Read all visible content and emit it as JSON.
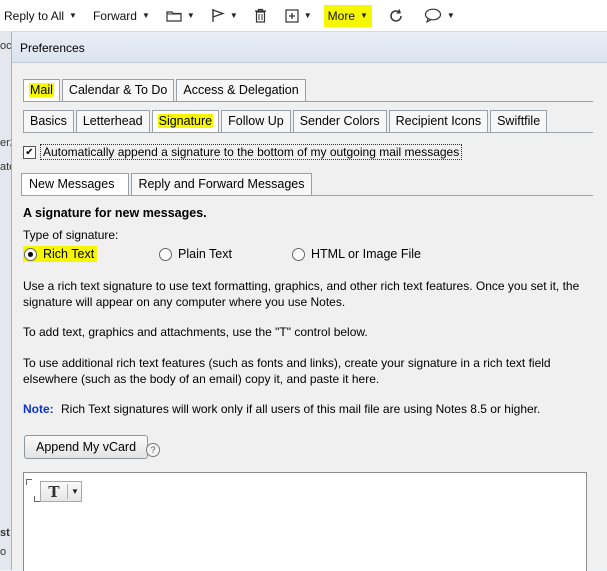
{
  "toolbar": {
    "reply_all": "Reply to All",
    "forward": "Forward",
    "more": "More",
    "icons": [
      "folder-icon",
      "flag-icon",
      "trash-icon",
      "add-box-icon",
      "refresh-icon",
      "chat-icon"
    ]
  },
  "dialog": {
    "title": "Preferences"
  },
  "main_tabs": [
    {
      "label": "Mail",
      "active": true
    },
    {
      "label": "Calendar & To Do",
      "active": false
    },
    {
      "label": "Access & Delegation",
      "active": false
    }
  ],
  "sub_tabs": [
    {
      "label": "Basics",
      "active": false
    },
    {
      "label": "Letterhead",
      "active": false
    },
    {
      "label": "Signature",
      "active": true
    },
    {
      "label": "Follow Up",
      "active": false
    },
    {
      "label": "Sender Colors",
      "active": false
    },
    {
      "label": "Recipient Icons",
      "active": false
    },
    {
      "label": "Swiftfile",
      "active": false
    }
  ],
  "auto_append": {
    "label": "Automatically append a signature to the bottom of my outgoing mail messages",
    "checked": true
  },
  "message_tabs": [
    {
      "label": "New Messages",
      "active": true
    },
    {
      "label": "Reply and Forward Messages",
      "active": false
    }
  ],
  "signature": {
    "heading": "A signature for new messages.",
    "type_label": "Type of signature:",
    "options": [
      {
        "label": "Rich Text",
        "selected": true
      },
      {
        "label": "Plain Text",
        "selected": false
      },
      {
        "label": "HTML or Image File",
        "selected": false
      }
    ],
    "para1": "Use a rich text signature to use text formatting, graphics, and other rich text features.   Once you set it, the signature will appear on any computer where you use Notes.",
    "para2": "To add text, graphics and attachments, use the \"T\" control below.",
    "para3": "To use additional rich text features (such as fonts and links), create your signature in a rich text field elsewhere (such as the body of an email) copy it, and paste it here.",
    "note_label": "Note:",
    "note_text": "Rich Text signatures will work only if all users of this mail file are using Notes 8.5 or higher.",
    "vcard_button": "Append My vCard",
    "help": "?",
    "t_control": "T"
  },
  "background_fragments": [
    "oc",
    "er2",
    "ate",
    "st",
    "o"
  ],
  "colors": {
    "highlight": "#f7f700",
    "note_blue": "#1033c7"
  }
}
